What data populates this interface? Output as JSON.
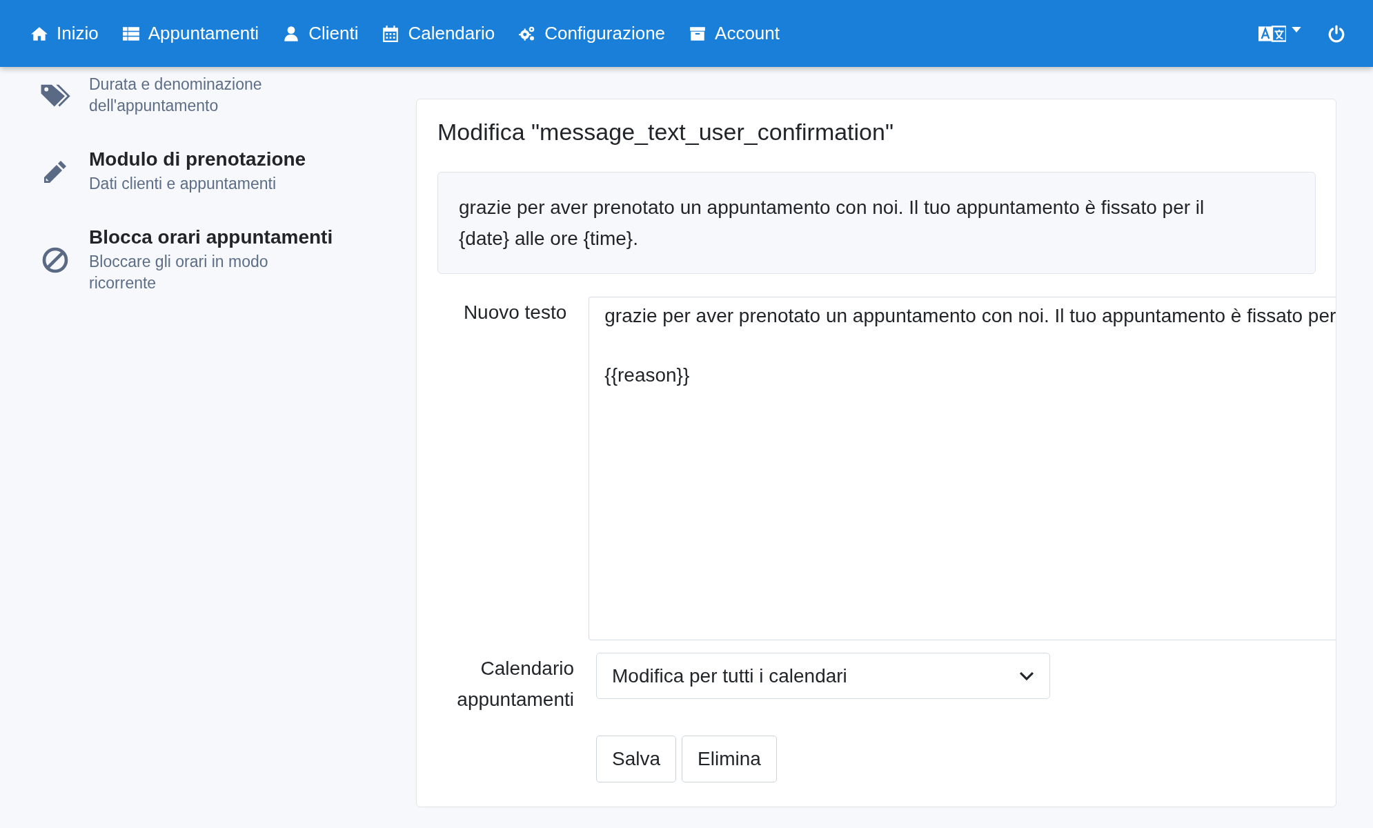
{
  "navbar": {
    "items": [
      {
        "label": "Inizio"
      },
      {
        "label": "Appuntamenti"
      },
      {
        "label": "Clienti"
      },
      {
        "label": "Calendario"
      },
      {
        "label": "Configurazione"
      },
      {
        "label": "Account"
      }
    ]
  },
  "sidebar": {
    "items": [
      {
        "description": "Durata e denominazione dell'appuntamento"
      },
      {
        "title": "Modulo di prenotazione",
        "description": "Dati clienti e appuntamenti"
      },
      {
        "title": "Blocca orari appuntamenti",
        "description": "Bloccare gli orari in modo ricorrente"
      }
    ]
  },
  "editor": {
    "title": "Modifica \"message_text_user_confirmation\"",
    "current_text": "grazie per aver prenotato un appuntamento con noi. Il tuo appuntamento è fissato per il {date} alle ore {time}.",
    "new_text": {
      "label": "Nuovo testo",
      "value": "grazie per aver prenotato un appuntamento con noi. Il tuo appuntamento è fissato per\n\n{{reason}}"
    },
    "calendar": {
      "label": "Calendario appuntamenti",
      "value": "Modifica per tutti i calendari"
    },
    "buttons": [
      "Salva",
      "Elimina"
    ]
  }
}
